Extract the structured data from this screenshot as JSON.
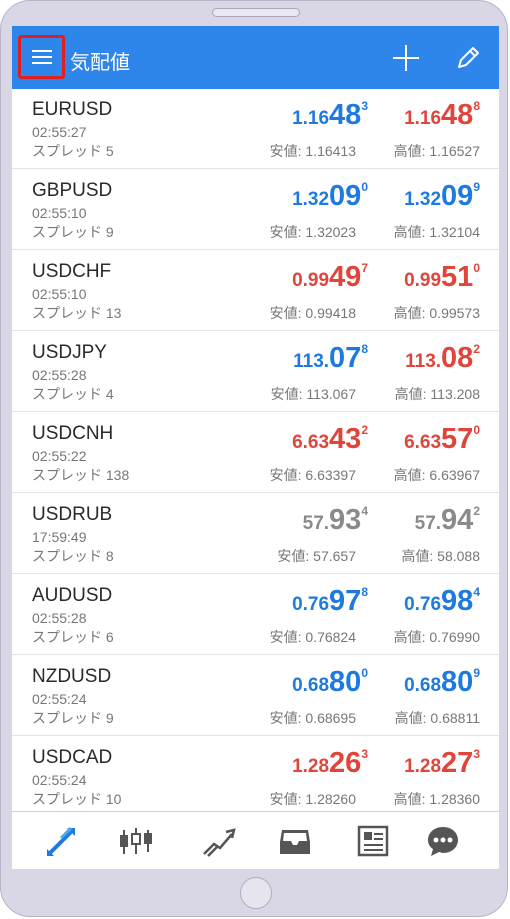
{
  "header": {
    "title": "気配値"
  },
  "quotes": [
    {
      "symbol": "EURUSD",
      "time": "02:55:27",
      "spread": "スプレッド 5",
      "bid": {
        "prefix": "1.16",
        "big": "48",
        "sup": "3",
        "color": "blue"
      },
      "ask": {
        "prefix": "1.16",
        "big": "48",
        "sup": "8",
        "color": "red"
      },
      "low": "安値: 1.16413",
      "high": "高値: 1.16527"
    },
    {
      "symbol": "GBPUSD",
      "time": "02:55:10",
      "spread": "スプレッド 9",
      "bid": {
        "prefix": "1.32",
        "big": "09",
        "sup": "0",
        "color": "blue"
      },
      "ask": {
        "prefix": "1.32",
        "big": "09",
        "sup": "9",
        "color": "blue"
      },
      "low": "安値: 1.32023",
      "high": "高値: 1.32104"
    },
    {
      "symbol": "USDCHF",
      "time": "02:55:10",
      "spread": "スプレッド 13",
      "bid": {
        "prefix": "0.99",
        "big": "49",
        "sup": "7",
        "color": "red"
      },
      "ask": {
        "prefix": "0.99",
        "big": "51",
        "sup": "0",
        "color": "red"
      },
      "low": "安値: 0.99418",
      "high": "高値: 0.99573"
    },
    {
      "symbol": "USDJPY",
      "time": "02:55:28",
      "spread": "スプレッド 4",
      "bid": {
        "prefix": "113.",
        "big": "07",
        "sup": "8",
        "color": "blue"
      },
      "ask": {
        "prefix": "113.",
        "big": "08",
        "sup": "2",
        "color": "red"
      },
      "low": "安値: 113.067",
      "high": "高値: 113.208"
    },
    {
      "symbol": "USDCNH",
      "time": "02:55:22",
      "spread": "スプレッド 138",
      "bid": {
        "prefix": "6.63",
        "big": "43",
        "sup": "2",
        "color": "red"
      },
      "ask": {
        "prefix": "6.63",
        "big": "57",
        "sup": "0",
        "color": "red"
      },
      "low": "安値: 6.63397",
      "high": "高値: 6.63967"
    },
    {
      "symbol": "USDRUB",
      "time": "17:59:49",
      "spread": "スプレッド 8",
      "bid": {
        "prefix": "57.",
        "big": "93",
        "sup": "4",
        "color": "gray"
      },
      "ask": {
        "prefix": "57.",
        "big": "94",
        "sup": "2",
        "color": "gray"
      },
      "low": "安値: 57.657",
      "high": "高値: 58.088"
    },
    {
      "symbol": "AUDUSD",
      "time": "02:55:28",
      "spread": "スプレッド 6",
      "bid": {
        "prefix": "0.76",
        "big": "97",
        "sup": "8",
        "color": "blue"
      },
      "ask": {
        "prefix": "0.76",
        "big": "98",
        "sup": "4",
        "color": "blue"
      },
      "low": "安値: 0.76824",
      "high": "高値: 0.76990"
    },
    {
      "symbol": "NZDUSD",
      "time": "02:55:24",
      "spread": "スプレッド 9",
      "bid": {
        "prefix": "0.68",
        "big": "80",
        "sup": "0",
        "color": "blue"
      },
      "ask": {
        "prefix": "0.68",
        "big": "80",
        "sup": "9",
        "color": "blue"
      },
      "low": "安値: 0.68695",
      "high": "高値: 0.68811"
    },
    {
      "symbol": "USDCAD",
      "time": "02:55:24",
      "spread": "スプレッド 10",
      "bid": {
        "prefix": "1.28",
        "big": "26",
        "sup": "3",
        "color": "red"
      },
      "ask": {
        "prefix": "1.28",
        "big": "27",
        "sup": "3",
        "color": "red"
      },
      "low": "安値: 1.28260",
      "high": "高値: 1.28360"
    }
  ],
  "colors": {
    "accent": "#2f86ea",
    "up": "#1f7ae0",
    "down": "#e0453c",
    "flat": "#8a8a8a",
    "highlight": "#e02020"
  },
  "nav_icons": [
    "quotes-icon",
    "chart-icon",
    "trade-icon",
    "inbox-icon",
    "news-icon",
    "chat-icon"
  ]
}
